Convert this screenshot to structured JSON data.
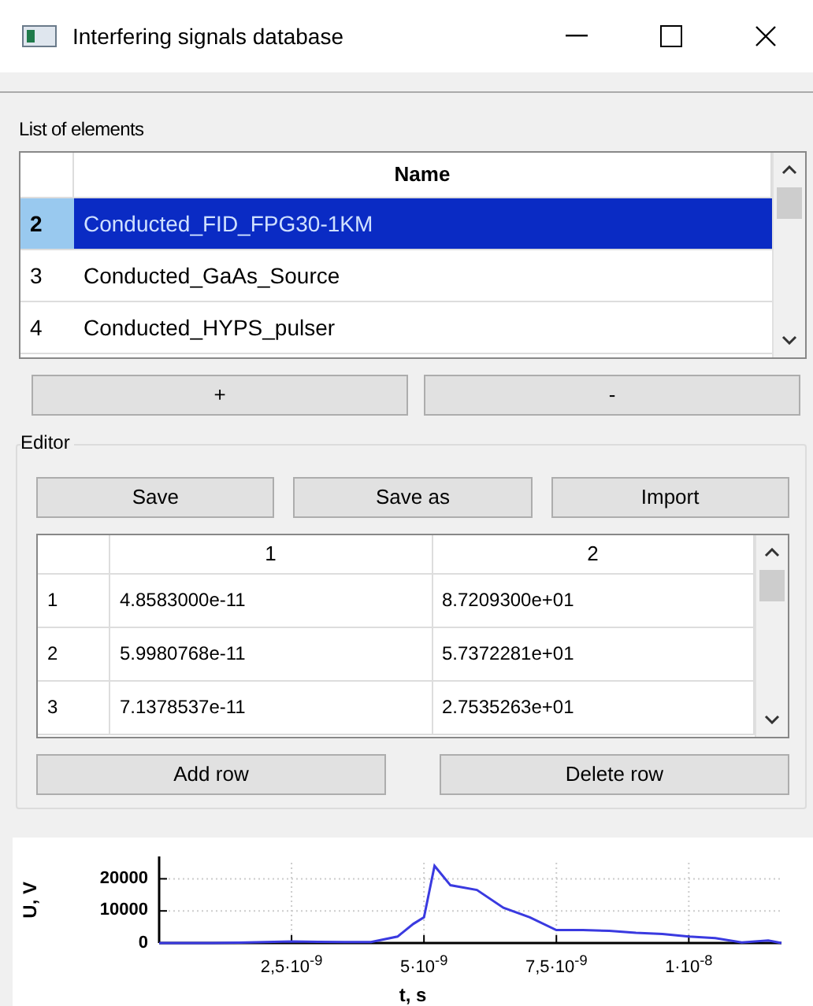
{
  "window": {
    "title": "Interfering signals database",
    "controls": [
      {
        "kind": "minimize"
      },
      {
        "kind": "maximize"
      },
      {
        "kind": "close"
      }
    ]
  },
  "elements": {
    "label": "List of elements",
    "header": "Name",
    "rows": [
      {
        "index": "2",
        "name": "Conducted_FID_FPG30-1KM",
        "selected": true
      },
      {
        "index": "3",
        "name": "Conducted_GaAs_Source",
        "selected": false
      },
      {
        "index": "4",
        "name": "Conducted_HYPS_pulser",
        "selected": false
      }
    ],
    "buttons": [
      "+",
      "-"
    ]
  },
  "editor": {
    "title": "Editor",
    "buttons": [
      "Save",
      "Save as",
      "Import"
    ],
    "table": {
      "columns": [
        "1",
        "2"
      ],
      "rows": [
        {
          "index": "1",
          "cells": [
            "4.8583000e-11",
            "8.7209300e+01"
          ]
        },
        {
          "index": "2",
          "cells": [
            "5.9980768e-11",
            "5.7372281e+01"
          ]
        },
        {
          "index": "3",
          "cells": [
            "7.1378537e-11",
            "2.7535263e+01"
          ]
        }
      ]
    },
    "row_buttons": [
      "Add row",
      "Delete row"
    ]
  },
  "chart_data": {
    "type": "line",
    "xlabel": "t, s",
    "ylabel": "U, V",
    "xlim": [
      0,
      1.175e-08
    ],
    "ylim": [
      0,
      25000
    ],
    "xticks": [
      {
        "value": 2.5e-09,
        "label": "2,5·10$^{-9}$"
      },
      {
        "value": 5e-09,
        "label": "5·10$^{-9}$"
      },
      {
        "value": 7.5e-09,
        "label": "7,5·10$^{-9}$"
      },
      {
        "value": 1e-08,
        "label": "1·10$^{-8}$"
      }
    ],
    "yticks": [
      0,
      10000,
      20000
    ],
    "x": [
      0,
      5e-10,
      1e-09,
      1.5e-09,
      2e-09,
      2.5e-09,
      3e-09,
      3.5e-09,
      4e-09,
      4.5e-09,
      4.8e-09,
      5e-09,
      5.2e-09,
      5.5e-09,
      6e-09,
      6.5e-09,
      7e-09,
      7.5e-09,
      8e-09,
      8.5e-09,
      9e-09,
      9.5e-09,
      1e-08,
      1.05e-08,
      1.1e-08,
      1.15e-08,
      1.175e-08
    ],
    "grid": true,
    "series": [
      {
        "color": "#3a3ae0",
        "values": [
          0,
          0,
          0,
          100,
          300,
          500,
          400,
          300,
          300,
          2000,
          6000,
          8000,
          24000,
          18000,
          16500,
          11000,
          8000,
          4000,
          4000,
          3800,
          3200,
          2800,
          2000,
          1500,
          200,
          800,
          0
        ]
      }
    ]
  }
}
